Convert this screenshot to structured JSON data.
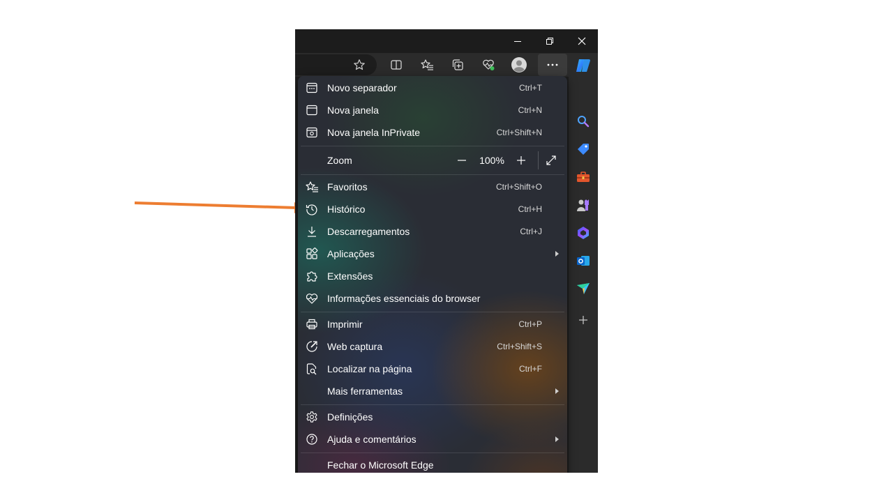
{
  "menu": {
    "new_tab": {
      "label": "Novo separador",
      "shortcut": "Ctrl+T",
      "icon": "new-tab-icon"
    },
    "new_window": {
      "label": "Nova janela",
      "shortcut": "Ctrl+N",
      "icon": "window-icon"
    },
    "new_inprivate": {
      "label": "Nova janela InPrivate",
      "shortcut": "Ctrl+Shift+N",
      "icon": "inprivate-icon"
    },
    "zoom": {
      "label": "Zoom",
      "value": "100%"
    },
    "favorites": {
      "label": "Favoritos",
      "shortcut": "Ctrl+Shift+O",
      "icon": "favorites-icon"
    },
    "history": {
      "label": "Histórico",
      "shortcut": "Ctrl+H",
      "icon": "history-icon"
    },
    "downloads": {
      "label": "Descarregamentos",
      "shortcut": "Ctrl+J",
      "icon": "download-icon"
    },
    "apps": {
      "label": "Aplicações",
      "icon": "apps-icon"
    },
    "extensions": {
      "label": "Extensões",
      "icon": "extensions-icon"
    },
    "essentials": {
      "label": "Informações essenciais do browser",
      "icon": "heartbeat-icon"
    },
    "print": {
      "label": "Imprimir",
      "shortcut": "Ctrl+P",
      "icon": "print-icon"
    },
    "web_capture": {
      "label": "Web captura",
      "shortcut": "Ctrl+Shift+S",
      "icon": "web-capture-icon"
    },
    "find": {
      "label": "Localizar na página",
      "shortcut": "Ctrl+F",
      "icon": "find-icon"
    },
    "more_tools": {
      "label": "Mais ferramentas"
    },
    "settings": {
      "label": "Definições",
      "icon": "gear-icon"
    },
    "help": {
      "label": "Ajuda e comentários",
      "icon": "help-icon"
    },
    "close": {
      "label": "Fechar o Microsoft Edge"
    }
  },
  "colors": {
    "annotation_arrow": "#ED7D31",
    "copilot_blue": "#2F9BFF",
    "sidebar_bg": "#2B2B2B",
    "titlebar_bg": "#1C1C1C"
  },
  "sidebar_icons": [
    "copilot-icon",
    "search-icon",
    "shopping-tag-icon",
    "tools-icon",
    "games-icon",
    "copilot-app-icon",
    "outlook-icon",
    "drop-icon",
    "add-icon"
  ]
}
